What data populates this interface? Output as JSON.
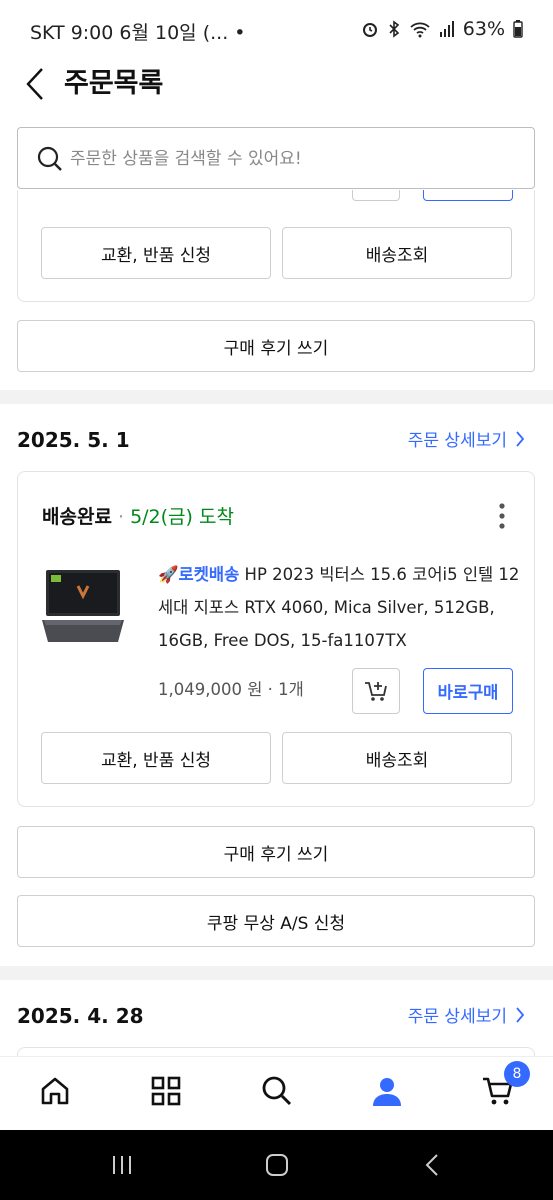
{
  "status_bar": {
    "left_text": "SKT 9:00   6월 10일 (... •",
    "battery": "63%"
  },
  "header": {
    "title": "주문목록"
  },
  "search": {
    "placeholder": "주문한 상품을 검색할 수 있어요!"
  },
  "prev_order": {
    "exchange_label": "교환, 반품 신청",
    "tracking_label": "배송조회",
    "review_label": "구매 후기 쓰기"
  },
  "order1": {
    "date": "2025. 5. 1",
    "detail_link": "주문 상세보기",
    "status": "배송완료",
    "separator": "·",
    "arrival": "5/2(금) 도착",
    "badge": "로켓배송",
    "product_name": "HP 2023 빅터스 15.6 코어i5 인텔 12세대 지포스 RTX 4060, Mica Silver, 512GB, 16GB, Free DOS, 15-fa1107TX",
    "price": "1,049,000 원 · 1개",
    "buy_now_label": "바로구매",
    "exchange_label": "교환, 반품 신청",
    "tracking_label": "배송조회",
    "review_label": "구매 후기 쓰기",
    "as_label": "쿠팡 무상 A/S 신청"
  },
  "order2": {
    "date": "2025. 4. 28",
    "detail_link": "주문 상세보기"
  },
  "bottom_nav": {
    "cart_count": "8"
  },
  "colors": {
    "accent": "#346aff",
    "arrival_green": "#00891a"
  }
}
